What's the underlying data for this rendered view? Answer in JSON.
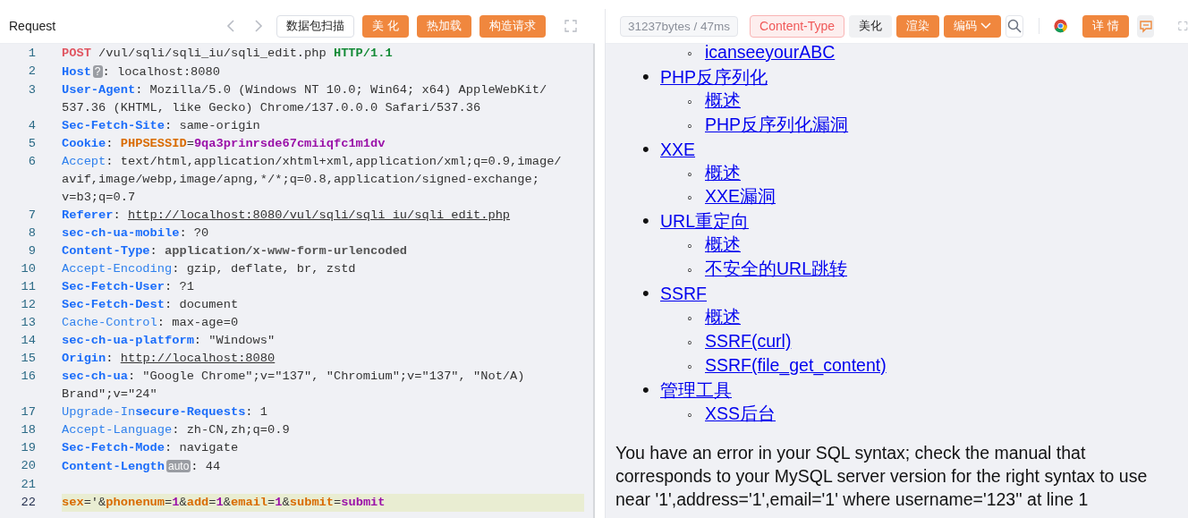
{
  "request": {
    "title": "Request",
    "buttons": [
      {
        "label": "数据包扫描",
        "kind": "outline"
      },
      {
        "label": "美 化",
        "kind": "primary"
      },
      {
        "label": "热加载",
        "kind": "primary"
      },
      {
        "label": "构造请求",
        "kind": "primary"
      }
    ],
    "lines": [
      {
        "number": "1",
        "current": false,
        "rows": [
          [
            {
              "kind": "method",
              "text": "POST"
            },
            {
              "kind": "plain",
              "text": " /vul/sqli/sqli_iu/sqli_edit.php "
            },
            {
              "kind": "version",
              "text": "HTTP/1.1"
            }
          ]
        ]
      },
      {
        "number": "2",
        "current": false,
        "rows": [
          [
            {
              "kind": "key",
              "text": "Host"
            },
            {
              "kind": "badge",
              "text": "?"
            },
            {
              "kind": "plain",
              "text": ": localhost:8080"
            }
          ]
        ]
      },
      {
        "number": "3",
        "current": false,
        "rows": [
          [
            {
              "kind": "key",
              "text": "User-Agent"
            },
            {
              "kind": "plain",
              "text": ": Mozilla/5.0 (Windows NT 10.0; Win64; x64) AppleWebKit/"
            }
          ],
          [
            {
              "kind": "plain",
              "text": "537.36 (KHTML, like Gecko) Chrome/137.0.0.0 Safari/537.36"
            }
          ]
        ]
      },
      {
        "number": "4",
        "current": false,
        "rows": [
          [
            {
              "kind": "key",
              "text": "Sec-Fetch-Site"
            },
            {
              "kind": "plain",
              "text": ": same-origin"
            }
          ]
        ]
      },
      {
        "number": "5",
        "current": false,
        "rows": [
          [
            {
              "kind": "key",
              "text": "Cookie"
            },
            {
              "kind": "plain",
              "text": ": "
            },
            {
              "kind": "param",
              "text": "PHPSESSID"
            },
            {
              "kind": "plain",
              "text": "="
            },
            {
              "kind": "value",
              "text": "9qa3prinrsde67cmiiqfc1m1dv"
            }
          ]
        ]
      },
      {
        "number": "6",
        "current": false,
        "rows": [
          [
            {
              "kind": "keylight",
              "text": "Accept"
            },
            {
              "kind": "plain",
              "text": ": text/html,application/xhtml+xml,application/xml;q=0.9,image/"
            }
          ],
          [
            {
              "kind": "plain",
              "text": "avif,image/webp,image/apng,*/*;q=0.8,application/signed-exchange;"
            }
          ],
          [
            {
              "kind": "plain",
              "text": "v=b3;q=0.7"
            }
          ]
        ]
      },
      {
        "number": "7",
        "current": false,
        "rows": [
          [
            {
              "kind": "key",
              "text": "Referer"
            },
            {
              "kind": "plain",
              "text": ": "
            },
            {
              "kind": "link",
              "text": "http://localhost:8080/vul/sqli/sqli_iu/sqli_edit.php"
            }
          ]
        ]
      },
      {
        "number": "8",
        "current": false,
        "rows": [
          [
            {
              "kind": "key",
              "text": "sec-ch-ua-mobile"
            },
            {
              "kind": "plain",
              "text": ": ?0"
            }
          ]
        ]
      },
      {
        "number": "9",
        "current": false,
        "rows": [
          [
            {
              "kind": "key",
              "text": "Content-Type"
            },
            {
              "kind": "plain",
              "text": ": "
            },
            {
              "kind": "strong",
              "text": "application/x-www-form-urlencoded"
            }
          ]
        ]
      },
      {
        "number": "10",
        "current": false,
        "rows": [
          [
            {
              "kind": "keylight",
              "text": "Accept-Encoding"
            },
            {
              "kind": "plain",
              "text": ": gzip, deflate, br, zstd"
            }
          ]
        ]
      },
      {
        "number": "11",
        "current": false,
        "rows": [
          [
            {
              "kind": "key",
              "text": "Sec-Fetch-User"
            },
            {
              "kind": "plain",
              "text": ": ?1"
            }
          ]
        ]
      },
      {
        "number": "12",
        "current": false,
        "rows": [
          [
            {
              "kind": "key",
              "text": "Sec-Fetch-Dest"
            },
            {
              "kind": "plain",
              "text": ": document"
            }
          ]
        ]
      },
      {
        "number": "13",
        "current": false,
        "rows": [
          [
            {
              "kind": "keylight",
              "text": "Cache-Control"
            },
            {
              "kind": "plain",
              "text": ": max-age=0"
            }
          ]
        ]
      },
      {
        "number": "14",
        "current": false,
        "rows": [
          [
            {
              "kind": "key",
              "text": "sec-ch-ua-platform"
            },
            {
              "kind": "plain",
              "text": ": \"Windows\""
            }
          ]
        ]
      },
      {
        "number": "15",
        "current": false,
        "rows": [
          [
            {
              "kind": "key",
              "text": "Origin"
            },
            {
              "kind": "plain",
              "text": ": "
            },
            {
              "kind": "link",
              "text": "http://localhost:8080"
            }
          ]
        ]
      },
      {
        "number": "16",
        "current": false,
        "rows": [
          [
            {
              "kind": "key",
              "text": "sec-ch-ua"
            },
            {
              "kind": "plain",
              "text": ": \"Google Chrome\";v=\"137\", \"Chromium\";v=\"137\", \"Not/A)"
            }
          ],
          [
            {
              "kind": "plain",
              "text": "Brand\";v=\"24\""
            }
          ]
        ]
      },
      {
        "number": "17",
        "current": false,
        "rows": [
          [
            {
              "kind": "keylight",
              "text": "Upgrade-In"
            },
            {
              "kind": "key",
              "text": "secure-Requests"
            },
            {
              "kind": "plain",
              "text": ": 1"
            }
          ]
        ]
      },
      {
        "number": "18",
        "current": false,
        "rows": [
          [
            {
              "kind": "keylight",
              "text": "Accept-Language"
            },
            {
              "kind": "plain",
              "text": ": zh-CN,zh;q=0.9"
            }
          ]
        ]
      },
      {
        "number": "19",
        "current": false,
        "rows": [
          [
            {
              "kind": "key",
              "text": "Sec-Fetch-Mode"
            },
            {
              "kind": "plain",
              "text": ": navigate"
            }
          ]
        ]
      },
      {
        "number": "20",
        "current": false,
        "rows": [
          [
            {
              "kind": "key",
              "text": "Content-Length"
            },
            {
              "kind": "badge",
              "text": "auto"
            },
            {
              "kind": "plain",
              "text": ": 44"
            }
          ]
        ]
      },
      {
        "number": "21",
        "current": false,
        "rows": [
          []
        ]
      },
      {
        "number": "22",
        "current": true,
        "rows": [
          [
            {
              "kind": "param",
              "text": "sex"
            },
            {
              "kind": "plain",
              "text": "='&"
            },
            {
              "kind": "param",
              "text": "phonenum"
            },
            {
              "kind": "plain",
              "text": "="
            },
            {
              "kind": "value",
              "text": "1"
            },
            {
              "kind": "plain",
              "text": "&"
            },
            {
              "kind": "param",
              "text": "add"
            },
            {
              "kind": "plain",
              "text": "="
            },
            {
              "kind": "value",
              "text": "1"
            },
            {
              "kind": "plain",
              "text": "&"
            },
            {
              "kind": "param",
              "text": "email"
            },
            {
              "kind": "plain",
              "text": "="
            },
            {
              "kind": "value",
              "text": "1"
            },
            {
              "kind": "plain",
              "text": "&"
            },
            {
              "kind": "param",
              "text": "submit"
            },
            {
              "kind": "plain",
              "text": "="
            },
            {
              "kind": "value",
              "text": "submit"
            }
          ]
        ]
      }
    ]
  },
  "response": {
    "stats": "31237bytes / 47ms",
    "tools": [
      {
        "label": "Content-Type",
        "kind": "danger"
      },
      {
        "label": "美化",
        "kind": "plain"
      },
      {
        "label": "渲染",
        "kind": "primary"
      },
      {
        "label": "编码",
        "kind": "dropdown"
      },
      {
        "kind": "search"
      },
      {
        "kind": "divider"
      },
      {
        "kind": "browser"
      },
      {
        "label": "详 情",
        "kind": "primary"
      },
      {
        "kind": "comment"
      }
    ],
    "menu": [
      {
        "children": [
          {
            "marker": "◦",
            "text": "icanseeyourABC"
          }
        ]
      },
      {
        "marker": "•",
        "text": "PHP反序列化",
        "children": [
          {
            "marker": "◦",
            "text": "概述"
          },
          {
            "marker": "◦",
            "text": "PHP反序列化漏洞"
          }
        ]
      },
      {
        "marker": "•",
        "text": "XXE",
        "children": [
          {
            "marker": "◦",
            "text": "概述"
          },
          {
            "marker": "◦",
            "text": "XXE漏洞"
          }
        ]
      },
      {
        "marker": "•",
        "text": "URL重定向",
        "children": [
          {
            "marker": "◦",
            "text": "概述"
          },
          {
            "marker": "◦",
            "text": "不安全的URL跳转"
          }
        ]
      },
      {
        "marker": "•",
        "text": "SSRF",
        "children": [
          {
            "marker": "◦",
            "text": "概述"
          },
          {
            "marker": "◦",
            "text": "SSRF(curl)"
          },
          {
            "marker": "◦",
            "text": "SSRF(file_get_content)"
          }
        ]
      },
      {
        "marker": "•",
        "text": "管理工具",
        "children": [
          {
            "marker": "◦",
            "text": "XSS后台"
          }
        ]
      }
    ],
    "error": "You have an error in your SQL syntax; check the manual that corresponds to your MySQL server version for the right syntax to use near '1',address='1',email='1' where username='123'' at line 1"
  }
}
